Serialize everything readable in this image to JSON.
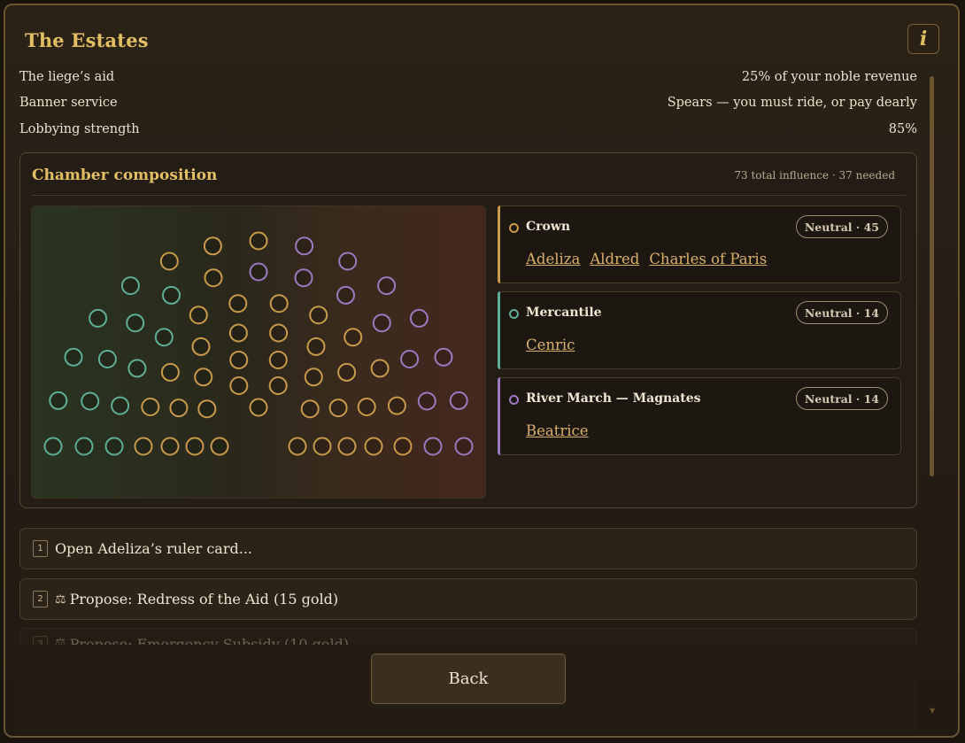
{
  "header": {
    "title": "The Estates",
    "info_icon": "i"
  },
  "stats": [
    {
      "label": "The liege’s aid",
      "value": "25% of your noble revenue"
    },
    {
      "label": "Banner service",
      "value": "Spears — you must ride, or pay dearly"
    },
    {
      "label": "Lobbying strength",
      "value": "85%"
    }
  ],
  "chamber": {
    "title": "Chamber composition",
    "summary": "73 total influence · 37 needed",
    "seat_counts": {
      "crown": 45,
      "mercantile": 14,
      "magnates": 14
    },
    "factions": [
      {
        "name": "Crown",
        "badge": "Neutral · 45",
        "color": "#c99a4a",
        "members": [
          "Adeliza",
          "Aldred",
          "Charles of Paris"
        ]
      },
      {
        "name": "Mercantile",
        "badge": "Neutral · 14",
        "color": "#5fae98",
        "members": [
          "Cenric"
        ]
      },
      {
        "name": "River March — Magnates",
        "badge": "Neutral · 14",
        "color": "#9c7ac0",
        "members": [
          "Beatrice"
        ]
      }
    ]
  },
  "options": [
    {
      "num": "1",
      "icon": "",
      "label": "Open Adeliza’s ruler card..."
    },
    {
      "num": "2",
      "icon": "⚖",
      "label": "Propose: Redress of the Aid (15 gold)"
    },
    {
      "num": "3",
      "icon": "⚖",
      "label": "Propose: Emergency Subsidy (10 gold)"
    }
  ],
  "footer": {
    "back_label": "Back"
  }
}
